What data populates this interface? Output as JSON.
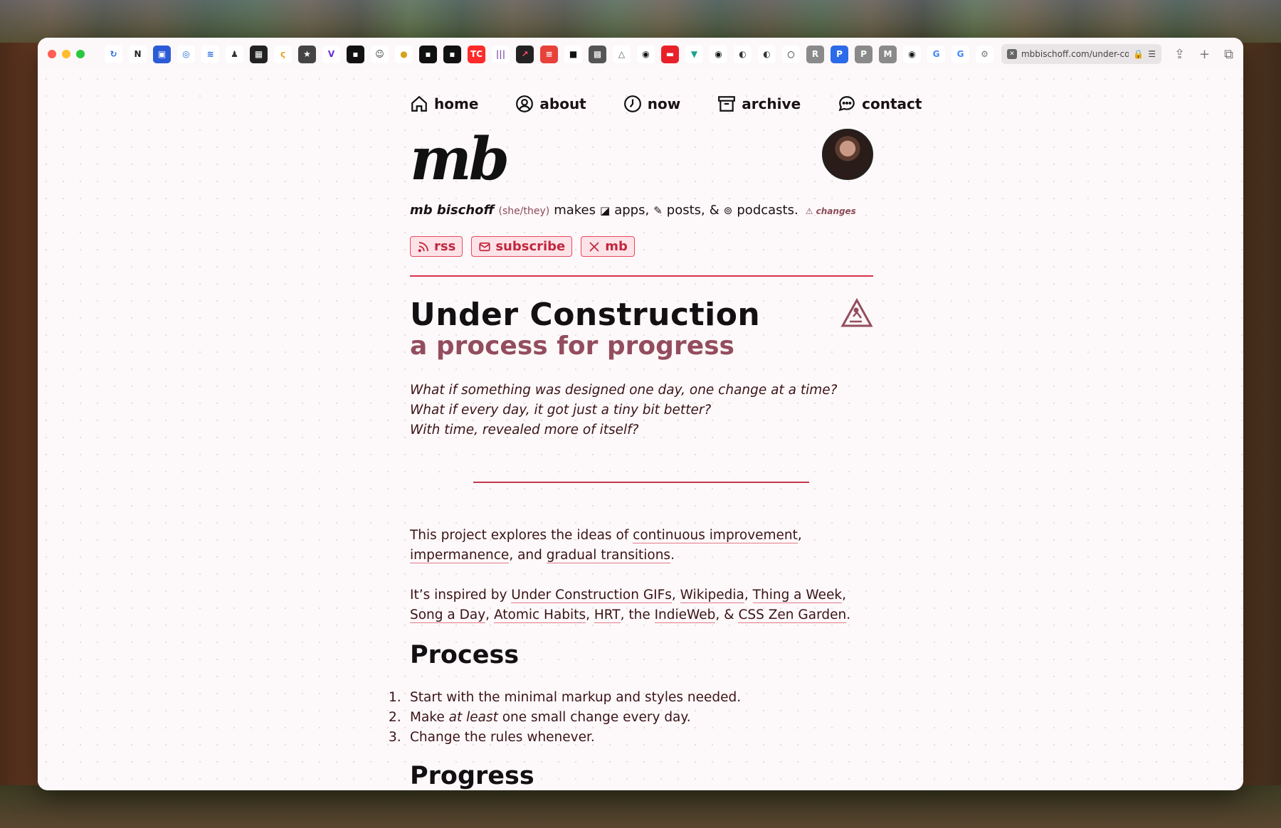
{
  "browser": {
    "url": "mbbischoff.com/under-co",
    "favicons": [
      {
        "name": "refresh-app-icon",
        "bg": "#ffffff",
        "fg": "#2a6ae0",
        "glyph": "↻"
      },
      {
        "name": "notion-icon",
        "bg": "#ffffff",
        "fg": "#222222",
        "glyph": "N"
      },
      {
        "name": "bracket-icon",
        "bg": "#2b5cd6",
        "fg": "#ffffff",
        "glyph": "▣"
      },
      {
        "name": "globe-lock-icon",
        "bg": "#ffffff",
        "fg": "#1b6bd6",
        "glyph": "◎"
      },
      {
        "name": "feed-icon",
        "bg": "#ffffff",
        "fg": "#2a6ae0",
        "glyph": "≋"
      },
      {
        "name": "person-icon",
        "bg": "#ffffff",
        "fg": "#333333",
        "glyph": "♟"
      },
      {
        "name": "clapper-icon",
        "bg": "#222222",
        "fg": "#ffffff",
        "glyph": "▦"
      },
      {
        "name": "swirl-icon",
        "bg": "#ffffff",
        "fg": "#e8a21f",
        "glyph": "ς"
      },
      {
        "name": "star-icon",
        "bg": "#444444",
        "fg": "#ffffff",
        "glyph": "★"
      },
      {
        "name": "v-icon",
        "bg": "#ffffff",
        "fg": "#6a2bd6",
        "glyph": "V"
      },
      {
        "name": "dark-square-icon",
        "bg": "#111111",
        "fg": "#ffffff",
        "glyph": "▪"
      },
      {
        "name": "face-icon",
        "bg": "#ffffff",
        "fg": "#333333",
        "glyph": "☺"
      },
      {
        "name": "coin-icon",
        "bg": "#ffffff",
        "fg": "#d6a21f",
        "glyph": "●"
      },
      {
        "name": "book-icon",
        "bg": "#111111",
        "fg": "#ffffff",
        "glyph": "▪"
      },
      {
        "name": "book2-icon",
        "bg": "#111111",
        "fg": "#ffffff",
        "glyph": "▪"
      },
      {
        "name": "tc-icon",
        "bg": "#ff2a2a",
        "fg": "#ffffff",
        "glyph": "TC"
      },
      {
        "name": "audio-icon",
        "bg": "#ffffff",
        "fg": "#8855aa",
        "glyph": "|||"
      },
      {
        "name": "chart-icon",
        "bg": "#222222",
        "fg": "#ff4a6a",
        "glyph": "↗"
      },
      {
        "name": "news-icon",
        "bg": "#e8413a",
        "fg": "#ffffff",
        "glyph": "≡"
      },
      {
        "name": "square-icon",
        "bg": "#ffffff",
        "fg": "#111111",
        "glyph": "■"
      },
      {
        "name": "pixel-icon",
        "bg": "#555555",
        "fg": "#ffffff",
        "glyph": "▩"
      },
      {
        "name": "triangle-icon",
        "bg": "#ffffff",
        "fg": "#555555",
        "glyph": "△"
      },
      {
        "name": "github-icon",
        "bg": "#ffffff",
        "fg": "#111111",
        "glyph": "◉"
      },
      {
        "name": "red-box-icon",
        "bg": "#e8202a",
        "fg": "#ffffff",
        "glyph": "▬"
      },
      {
        "name": "bird-icon",
        "bg": "#ffffff",
        "fg": "#1aa38f",
        "glyph": "▼"
      },
      {
        "name": "github2-icon",
        "bg": "#ffffff",
        "fg": "#111111",
        "glyph": "◉"
      },
      {
        "name": "zen-icon",
        "bg": "#ffffff",
        "fg": "#333333",
        "glyph": "◐"
      },
      {
        "name": "zen2-icon",
        "bg": "#ffffff",
        "fg": "#333333",
        "glyph": "◐"
      },
      {
        "name": "ring-icon",
        "bg": "#ffffff",
        "fg": "#111111",
        "glyph": "○"
      },
      {
        "name": "r-icon",
        "bg": "#8a8a8a",
        "fg": "#ffffff",
        "glyph": "R"
      },
      {
        "name": "p-blue-icon",
        "bg": "#2b6ae8",
        "fg": "#ffffff",
        "glyph": "P"
      },
      {
        "name": "p-gray-icon",
        "bg": "#8a8a8a",
        "fg": "#ffffff",
        "glyph": "P"
      },
      {
        "name": "m-icon",
        "bg": "#8a8a8a",
        "fg": "#ffffff",
        "glyph": "M"
      },
      {
        "name": "github3-icon",
        "bg": "#ffffff",
        "fg": "#111111",
        "glyph": "◉"
      },
      {
        "name": "google-icon",
        "bg": "#ffffff",
        "fg": "#4285f4",
        "glyph": "G"
      },
      {
        "name": "google2-icon",
        "bg": "#ffffff",
        "fg": "#4285f4",
        "glyph": "G"
      },
      {
        "name": "gear-icon",
        "bg": "#ffffff",
        "fg": "#777777",
        "glyph": "⚙"
      }
    ]
  },
  "nav": {
    "home": "home",
    "about": "about",
    "now": "now",
    "archive": "archive",
    "contact": "contact"
  },
  "header": {
    "logo": "mb",
    "name": "mb bischoff",
    "pronouns": "(she/they)",
    "makes": "makes",
    "apps": "apps,",
    "posts": "posts,",
    "amp": "&",
    "podcasts": "podcasts.",
    "changes": "changes"
  },
  "links": {
    "rss": "rss",
    "subscribe": "subscribe",
    "x": "mb"
  },
  "article": {
    "title": "Under Construction",
    "subtitle": "a process for progress",
    "intro": [
      "What if something was designed one day, one change at a time?",
      "What if every day, it got just a tiny bit better?",
      "With time, revealed more of itself?"
    ],
    "p1": {
      "pre": "This project explores the ideas of ",
      "l1": "continuous improvement",
      "c1": ",",
      "l2": "impermanence",
      "c2": ", and ",
      "l3": "gradual transitions",
      "end": "."
    },
    "p2": {
      "pre": "It’s inspired by ",
      "l1": "Under Construction GIFs",
      "l2": "Wikipedia",
      "l3": "Thing a Week",
      "l4": "Song a Day",
      "l5": "Atomic Habits",
      "l6": "HRT",
      "the": ", the ",
      "l7": "IndieWeb",
      "amp": ", & ",
      "l8": "CSS Zen Garden",
      "end": "."
    },
    "process_heading": "Process",
    "process_steps": [
      {
        "num": "1.",
        "a": "Start with the minimal markup and styles needed.",
        "em": "",
        "b": ""
      },
      {
        "num": "2.",
        "a": "Make ",
        "em": "at least",
        "b": " one small change every day."
      },
      {
        "num": "3.",
        "a": "Change the rules whenever.",
        "em": "",
        "b": ""
      }
    ],
    "progress_heading": "Progress"
  },
  "colors": {
    "accent": "#d8324a",
    "subtitle": "#934d5e",
    "text": "#3a1418"
  }
}
